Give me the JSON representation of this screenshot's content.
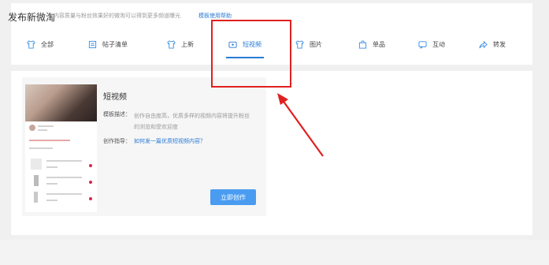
{
  "header": {
    "title": "发布新微淘",
    "description": "内容质量与粉丝效果好的微淘可以得到更多频道曝光",
    "help_link": "模板使用帮助"
  },
  "tabs": [
    {
      "label": "全部",
      "icon": "shirt-icon"
    },
    {
      "label": "帖子清单",
      "icon": "list-icon"
    },
    {
      "label": "上新",
      "icon": "shirt-icon"
    },
    {
      "label": "短视频",
      "icon": "video-icon",
      "active": true
    },
    {
      "label": "图片",
      "icon": "shirt-icon"
    },
    {
      "label": "单品",
      "icon": "bag-icon"
    },
    {
      "label": "互动",
      "icon": "chat-icon"
    },
    {
      "label": "转发",
      "icon": "share-icon"
    }
  ],
  "template_card": {
    "title": "短视频",
    "desc_label": "模板描述：",
    "desc_text": "创作自由度高，优质多样的视频内容将提升粉丝的浏览和受欢迎度",
    "guide_label": "创作指导：",
    "guide_link": "如何发一篇优质短视频内容？",
    "button_label": "立即创作"
  },
  "colors": {
    "accent": "#2a7ad6",
    "annotation": "#e02020",
    "button": "#4a9cf0"
  }
}
